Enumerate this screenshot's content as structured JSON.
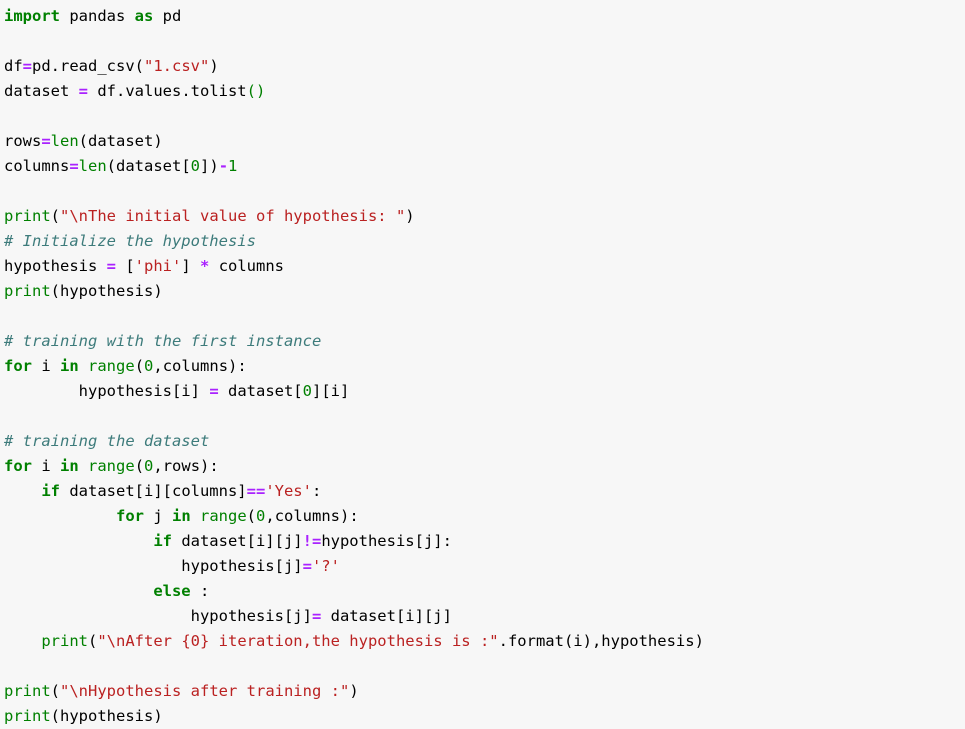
{
  "editor": {
    "language": "python",
    "background_color": "#f7f7f7",
    "default_text_color": "#000000",
    "palette": {
      "keyword": "#008000",
      "builtin": "#008000",
      "string": "#BA2121",
      "comment": "#3D7B7B",
      "operator": "#AA22FF",
      "number": "#008000",
      "plain": "#000000"
    }
  },
  "code": {
    "full_text": "import pandas as pd\n\ndf=pd.read_csv(\"1.csv\")\ndataset = df.values.tolist()\n\nrows=len(dataset)\ncolumns=len(dataset[0])-1\n\nprint(\"\\nThe initial value of hypothesis: \")\n# Initialize the hypothesis\nhypothesis = ['phi'] * columns\nprint(hypothesis)\n\n# training with the first instance\nfor i in range(0,columns):\n        hypothesis[i] = dataset[0][i]\n\n# training the dataset\nfor i in range(0,rows):\n    if dataset[i][columns]=='Yes':\n            for j in range(0,columns):\n                if dataset[i][j]!=hypothesis[j]:\n                   hypothesis[j]='?'\n                else :\n                    hypothesis[j]= dataset[i][j]\n    print(\"\\nAfter {0} iteration,the hypothesis is :\".format(i),hypothesis)\n\nprint(\"\\nHypothesis after training :\")\nprint(hypothesis)",
    "lines": [
      {
        "n": 1,
        "tokens": [
          {
            "t": "import",
            "c": "kw"
          },
          {
            "t": " pandas ",
            "c": "pl"
          },
          {
            "t": "as",
            "c": "kw"
          },
          {
            "t": " pd",
            "c": "pl"
          }
        ]
      },
      {
        "n": 2,
        "tokens": []
      },
      {
        "n": 3,
        "tokens": [
          {
            "t": "df",
            "c": "pl"
          },
          {
            "t": "=",
            "c": "op"
          },
          {
            "t": "pd.read_csv(",
            "c": "pl"
          },
          {
            "t": "\"1.csv\"",
            "c": "str"
          },
          {
            "t": ")",
            "c": "pl"
          }
        ]
      },
      {
        "n": 4,
        "tokens": [
          {
            "t": "dataset ",
            "c": "pl"
          },
          {
            "t": "=",
            "c": "op"
          },
          {
            "t": " df.values.tolist",
            "c": "pl"
          },
          {
            "t": "()",
            "c": "par"
          }
        ]
      },
      {
        "n": 5,
        "tokens": []
      },
      {
        "n": 6,
        "tokens": [
          {
            "t": "rows",
            "c": "pl"
          },
          {
            "t": "=",
            "c": "op"
          },
          {
            "t": "len",
            "c": "bi"
          },
          {
            "t": "(dataset)",
            "c": "pl"
          }
        ]
      },
      {
        "n": 7,
        "tokens": [
          {
            "t": "columns",
            "c": "pl"
          },
          {
            "t": "=",
            "c": "op"
          },
          {
            "t": "len",
            "c": "bi"
          },
          {
            "t": "(dataset[",
            "c": "pl"
          },
          {
            "t": "0",
            "c": "num"
          },
          {
            "t": "])",
            "c": "pl"
          },
          {
            "t": "-",
            "c": "op"
          },
          {
            "t": "1",
            "c": "num"
          }
        ]
      },
      {
        "n": 8,
        "tokens": []
      },
      {
        "n": 9,
        "tokens": [
          {
            "t": "print",
            "c": "bi"
          },
          {
            "t": "(",
            "c": "pl"
          },
          {
            "t": "\"\\nThe initial value of hypothesis: \"",
            "c": "str"
          },
          {
            "t": ")",
            "c": "pl"
          }
        ]
      },
      {
        "n": 10,
        "tokens": [
          {
            "t": "# Initialize the hypothesis",
            "c": "com"
          }
        ]
      },
      {
        "n": 11,
        "tokens": [
          {
            "t": "hypothesis ",
            "c": "pl"
          },
          {
            "t": "=",
            "c": "op"
          },
          {
            "t": " [",
            "c": "pl"
          },
          {
            "t": "'phi'",
            "c": "str"
          },
          {
            "t": "] ",
            "c": "pl"
          },
          {
            "t": "*",
            "c": "op"
          },
          {
            "t": " columns",
            "c": "pl"
          }
        ]
      },
      {
        "n": 12,
        "tokens": [
          {
            "t": "print",
            "c": "bi"
          },
          {
            "t": "(hypothesis)",
            "c": "pl"
          }
        ]
      },
      {
        "n": 13,
        "tokens": []
      },
      {
        "n": 14,
        "tokens": [
          {
            "t": "# training with the first instance",
            "c": "com"
          }
        ]
      },
      {
        "n": 15,
        "tokens": [
          {
            "t": "for",
            "c": "kw"
          },
          {
            "t": " i ",
            "c": "pl"
          },
          {
            "t": "in",
            "c": "kw"
          },
          {
            "t": " ",
            "c": "pl"
          },
          {
            "t": "range",
            "c": "bi"
          },
          {
            "t": "(",
            "c": "pl"
          },
          {
            "t": "0",
            "c": "num"
          },
          {
            "t": ",columns):",
            "c": "pl"
          }
        ]
      },
      {
        "n": 16,
        "tokens": [
          {
            "t": "        hypothesis[i] ",
            "c": "pl"
          },
          {
            "t": "=",
            "c": "op"
          },
          {
            "t": " dataset[",
            "c": "pl"
          },
          {
            "t": "0",
            "c": "num"
          },
          {
            "t": "][i]",
            "c": "pl"
          }
        ]
      },
      {
        "n": 17,
        "tokens": []
      },
      {
        "n": 18,
        "tokens": [
          {
            "t": "# training the dataset",
            "c": "com"
          }
        ]
      },
      {
        "n": 19,
        "tokens": [
          {
            "t": "for",
            "c": "kw"
          },
          {
            "t": " i ",
            "c": "pl"
          },
          {
            "t": "in",
            "c": "kw"
          },
          {
            "t": " ",
            "c": "pl"
          },
          {
            "t": "range",
            "c": "bi"
          },
          {
            "t": "(",
            "c": "pl"
          },
          {
            "t": "0",
            "c": "num"
          },
          {
            "t": ",rows):",
            "c": "pl"
          }
        ]
      },
      {
        "n": 20,
        "tokens": [
          {
            "t": "    ",
            "c": "pl"
          },
          {
            "t": "if",
            "c": "kw"
          },
          {
            "t": " dataset[i][columns]",
            "c": "pl"
          },
          {
            "t": "==",
            "c": "op"
          },
          {
            "t": "'Yes'",
            "c": "str"
          },
          {
            "t": ":",
            "c": "pl"
          }
        ]
      },
      {
        "n": 21,
        "tokens": [
          {
            "t": "            ",
            "c": "pl"
          },
          {
            "t": "for",
            "c": "kw"
          },
          {
            "t": " j ",
            "c": "pl"
          },
          {
            "t": "in",
            "c": "kw"
          },
          {
            "t": " ",
            "c": "pl"
          },
          {
            "t": "range",
            "c": "bi"
          },
          {
            "t": "(",
            "c": "pl"
          },
          {
            "t": "0",
            "c": "num"
          },
          {
            "t": ",columns):",
            "c": "pl"
          }
        ]
      },
      {
        "n": 22,
        "tokens": [
          {
            "t": "                ",
            "c": "pl"
          },
          {
            "t": "if",
            "c": "kw"
          },
          {
            "t": " dataset[i][j]",
            "c": "pl"
          },
          {
            "t": "!=",
            "c": "op"
          },
          {
            "t": "hypothesis[j]:",
            "c": "pl"
          }
        ]
      },
      {
        "n": 23,
        "tokens": [
          {
            "t": "                   hypothesis[j]",
            "c": "pl"
          },
          {
            "t": "=",
            "c": "op"
          },
          {
            "t": "'?'",
            "c": "str"
          }
        ]
      },
      {
        "n": 24,
        "tokens": [
          {
            "t": "                ",
            "c": "pl"
          },
          {
            "t": "else",
            "c": "kw"
          },
          {
            "t": " :",
            "c": "pl"
          }
        ]
      },
      {
        "n": 25,
        "tokens": [
          {
            "t": "                    hypothesis[j]",
            "c": "pl"
          },
          {
            "t": "=",
            "c": "op"
          },
          {
            "t": " dataset[i][j]",
            "c": "pl"
          }
        ]
      },
      {
        "n": 26,
        "tokens": [
          {
            "t": "    ",
            "c": "pl"
          },
          {
            "t": "print",
            "c": "bi"
          },
          {
            "t": "(",
            "c": "pl"
          },
          {
            "t": "\"\\nAfter {0} iteration,the hypothesis is :\"",
            "c": "str"
          },
          {
            "t": ".format(i),hypothesis)",
            "c": "pl"
          }
        ]
      },
      {
        "n": 27,
        "tokens": []
      },
      {
        "n": 28,
        "tokens": [
          {
            "t": "print",
            "c": "bi"
          },
          {
            "t": "(",
            "c": "pl"
          },
          {
            "t": "\"\\nHypothesis after training :\"",
            "c": "str"
          },
          {
            "t": ")",
            "c": "pl"
          }
        ]
      },
      {
        "n": 29,
        "tokens": [
          {
            "t": "print",
            "c": "bi"
          },
          {
            "t": "(hypothesis)",
            "c": "pl"
          }
        ]
      }
    ]
  }
}
